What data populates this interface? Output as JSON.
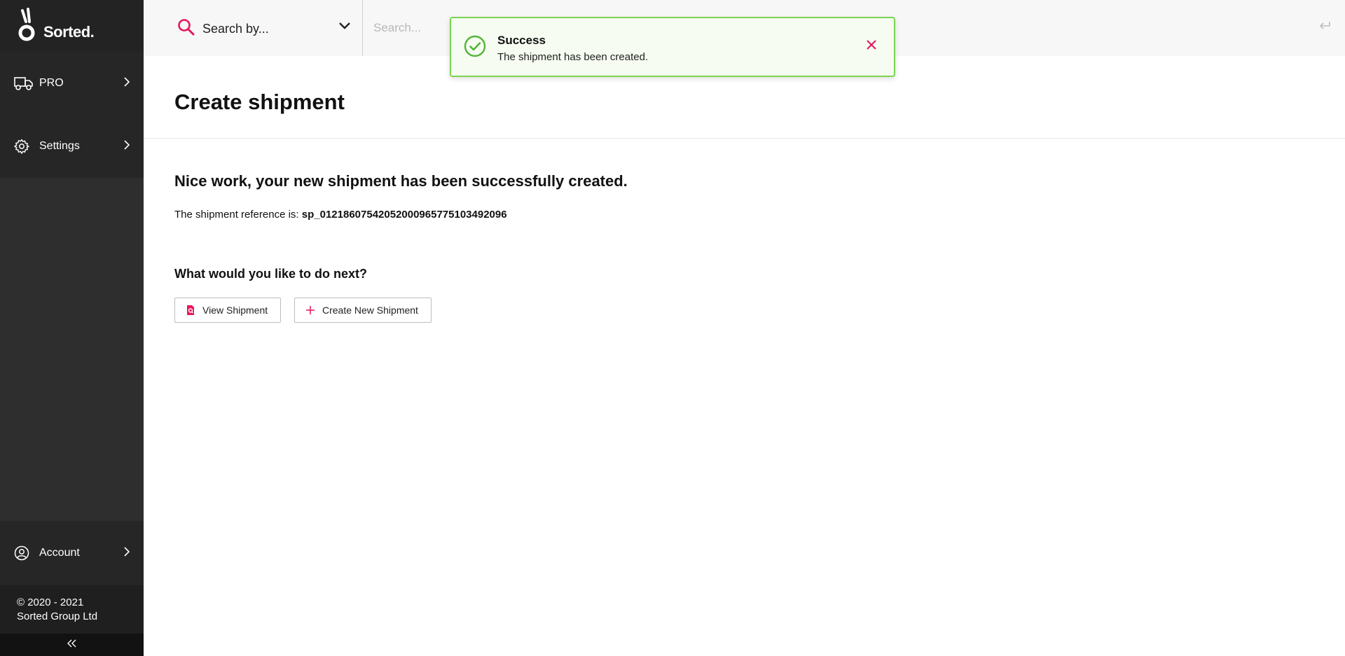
{
  "brand": {
    "name": "Sorted.",
    "accent": "#e6175c",
    "success": "#52b43a"
  },
  "sidebar": {
    "items": [
      {
        "label": "PRO",
        "icon": "truck-icon"
      },
      {
        "label": "Settings",
        "icon": "gear-icon"
      }
    ],
    "account_label": "Account",
    "copyright_line1": "© 2020 - 2021",
    "copyright_line2": "Sorted Group Ltd"
  },
  "topbar": {
    "search_by_label": "Search by...",
    "search_placeholder": "Search..."
  },
  "toast": {
    "title": "Success",
    "message": "The shipment has been created."
  },
  "main": {
    "page_title": "Create shipment",
    "heading": "Nice work, your new shipment has been successfully created.",
    "reference_label": "The shipment reference is:",
    "reference_value": "sp_01218607542052000965775103492096",
    "next_heading": "What would you like to do next?",
    "view_button": "View Shipment",
    "create_button": "Create New Shipment"
  }
}
